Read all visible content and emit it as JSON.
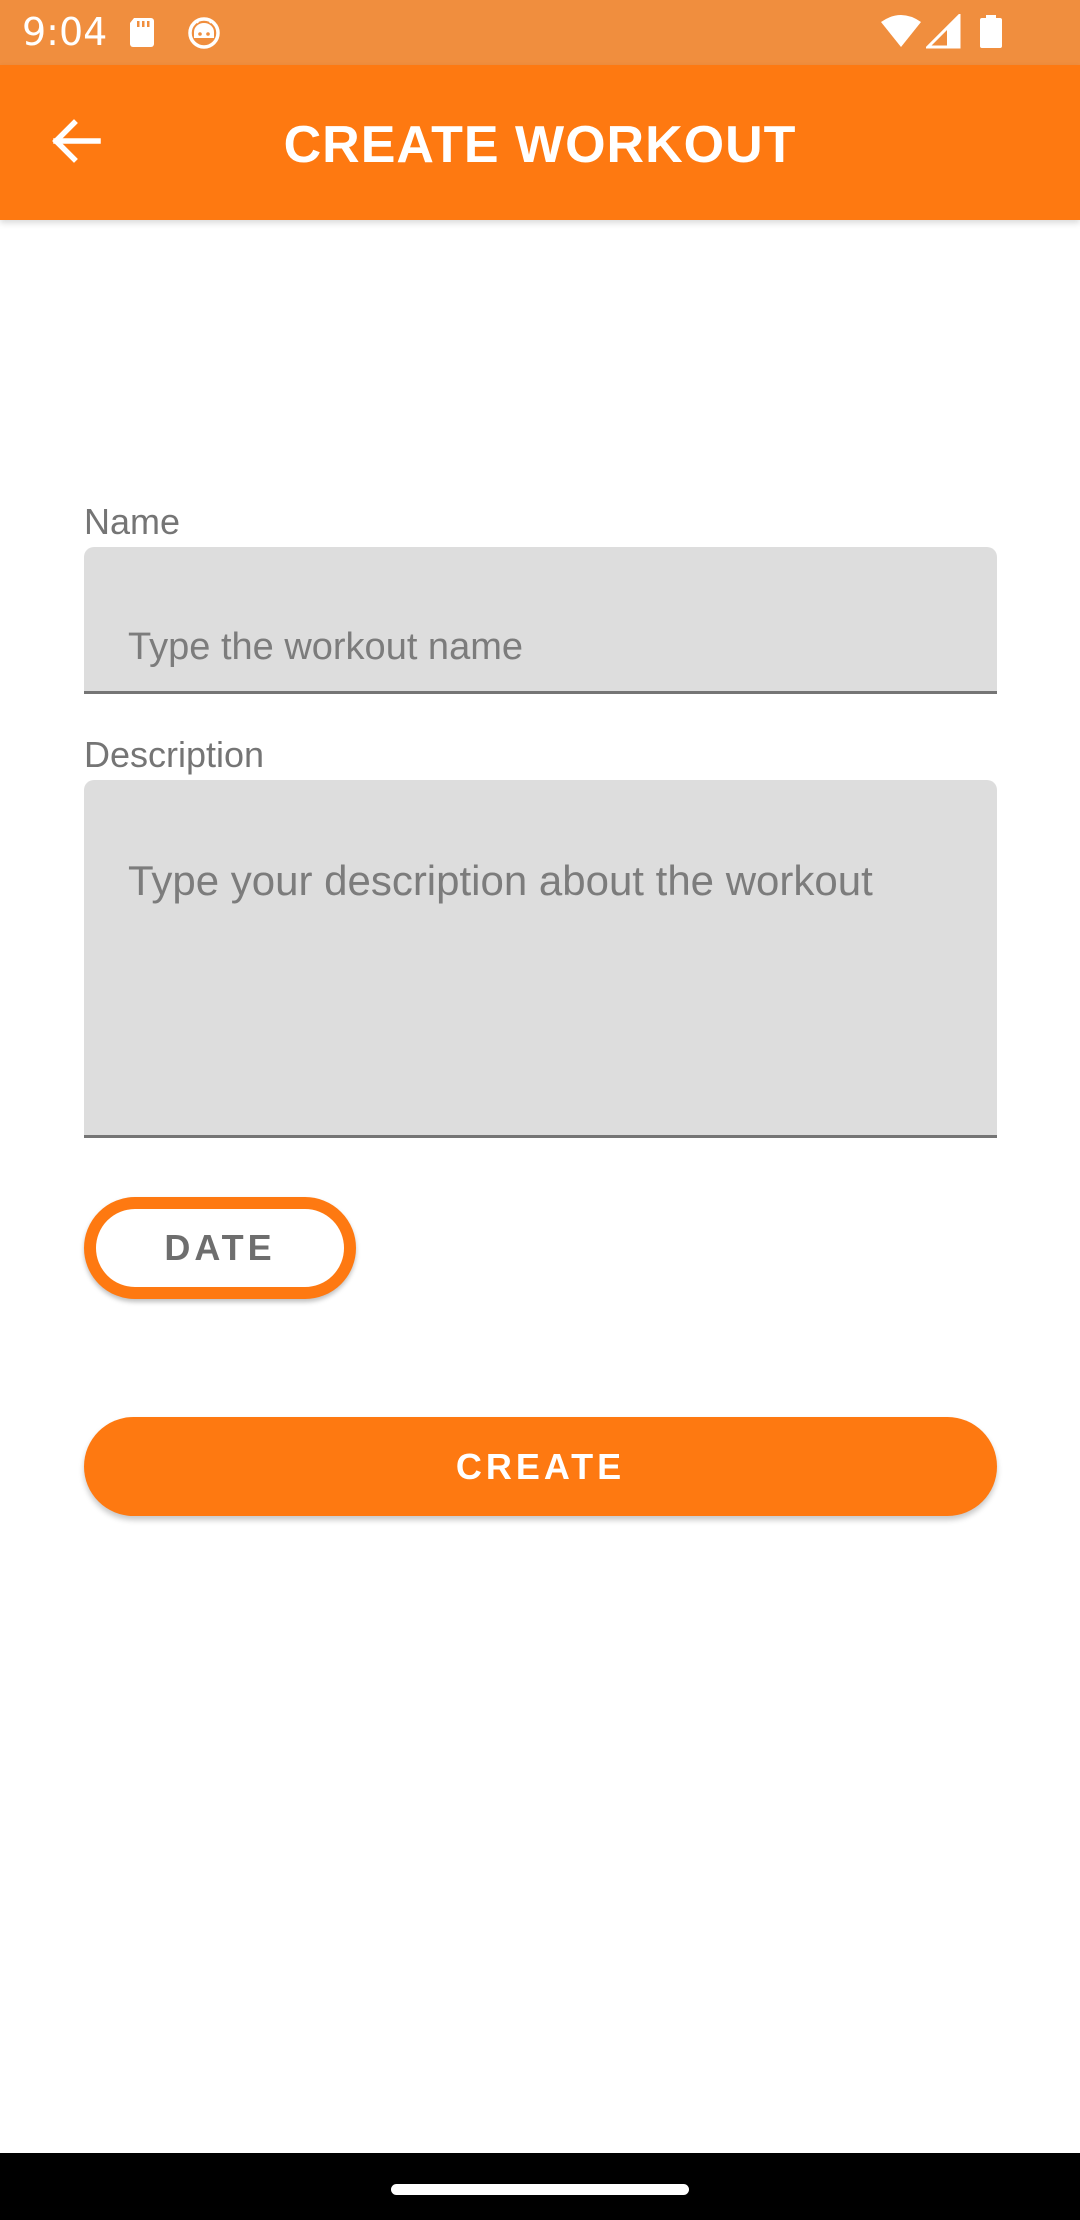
{
  "status_bar": {
    "time": "9:04",
    "background_color": "#f08e3e",
    "icons": [
      "sd-card-icon",
      "android-icon",
      "wifi-icon",
      "signal-icon",
      "battery-icon"
    ]
  },
  "app_bar": {
    "title": "CREATE WORKOUT",
    "back_icon": "arrow-left-icon",
    "background_color": "#fe7911"
  },
  "form": {
    "name": {
      "label": "Name",
      "placeholder": "Type the workout name",
      "value": ""
    },
    "description": {
      "label": "Description",
      "placeholder": "Type your description about the workout",
      "value": ""
    },
    "date_button_label": "DATE",
    "create_button_label": "CREATE"
  },
  "colors": {
    "accent": "#fe7911",
    "field_background": "#dddddd",
    "label_text": "#757575"
  }
}
